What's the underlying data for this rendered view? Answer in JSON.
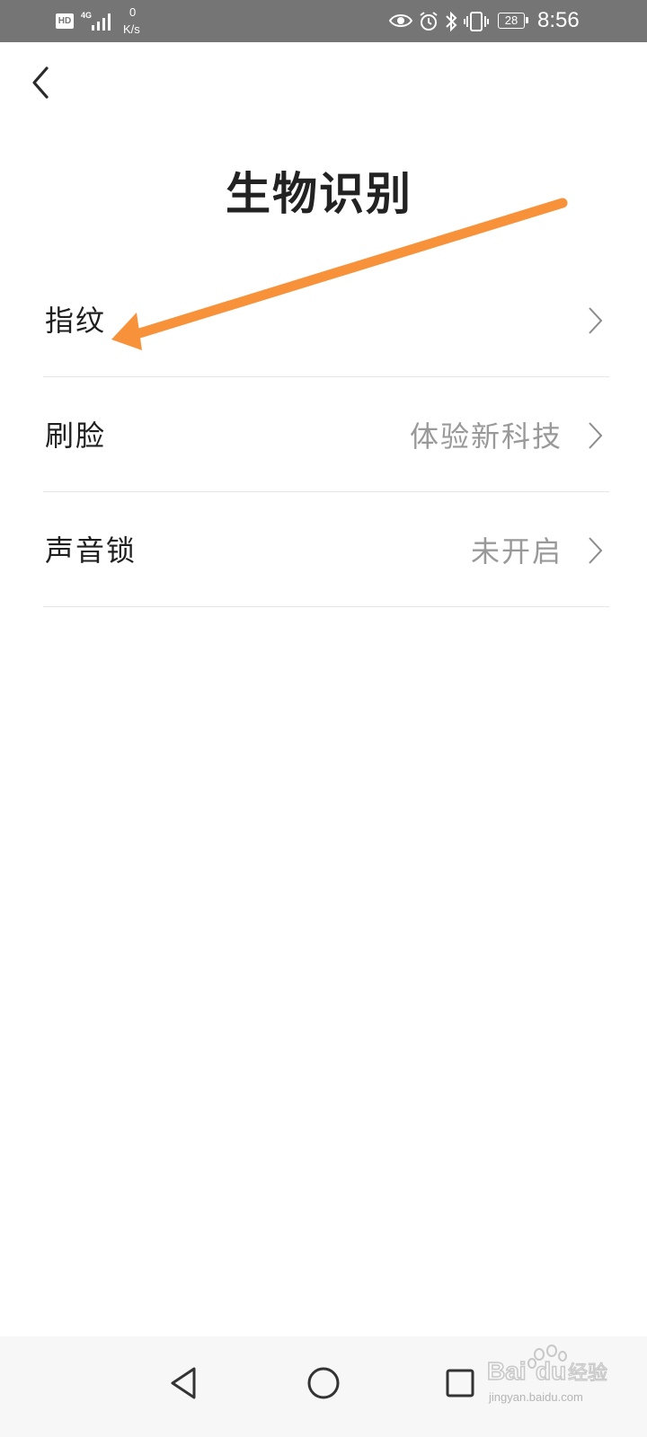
{
  "status_bar": {
    "hd": "HD",
    "network": "4G",
    "speed_value": "0",
    "speed_unit": "K/s",
    "icons": [
      "eye-icon",
      "alarm-icon",
      "bluetooth-icon",
      "vibrate-icon"
    ],
    "battery": "28",
    "time": "8:56"
  },
  "header": {
    "back_icon": "chevron-left-icon",
    "title": "生物识别"
  },
  "items": [
    {
      "label": "指纹",
      "value": ""
    },
    {
      "label": "刷脸",
      "value": "体验新科技"
    },
    {
      "label": "声音锁",
      "value": "未开启"
    }
  ],
  "annotation": {
    "color": "#f7923a"
  },
  "nav_bar": {
    "buttons": [
      "back-triangle-icon",
      "home-circle-icon",
      "recents-square-icon"
    ]
  },
  "watermark": {
    "logo": "Bai du 经验",
    "url": "jingyan.baidu.com"
  }
}
